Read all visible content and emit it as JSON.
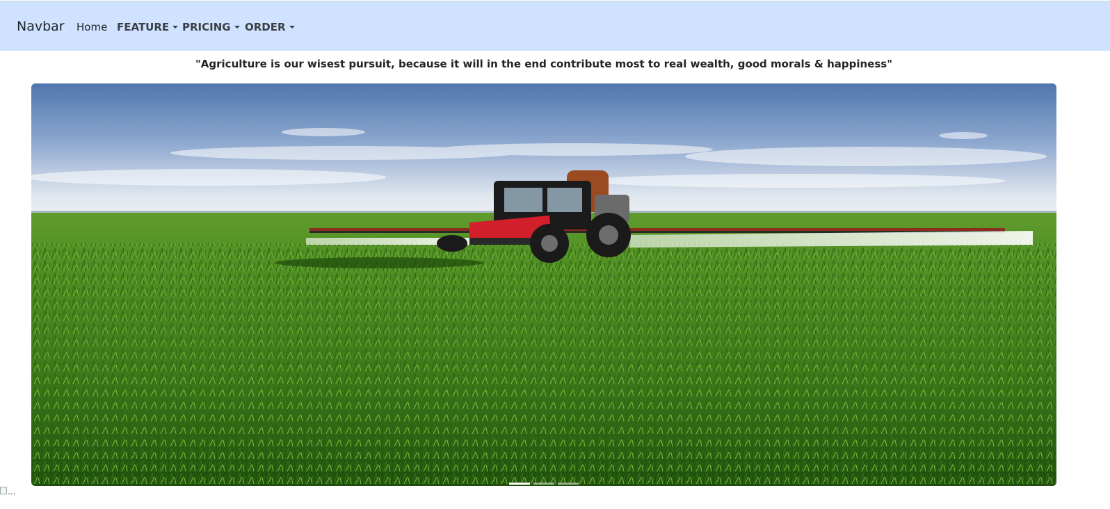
{
  "navbar": {
    "brand": "Navbar",
    "items": [
      {
        "label": "Home",
        "dropdown": false
      },
      {
        "label": "FEATURE",
        "dropdown": true
      },
      {
        "label": "PRICING",
        "dropdown": true
      },
      {
        "label": "ORDER",
        "dropdown": true
      }
    ]
  },
  "quote": "\"Agriculture is our wisest pursuit, because it will in the end contribute most to real wealth, good morals & happiness\"",
  "carousel": {
    "slide_count": 3,
    "active_index": 0
  },
  "broken_image": {
    "alt": "..."
  },
  "colors": {
    "navbar_bg": "#cfe2ff",
    "field_green": "#3f7f1d",
    "tractor_red": "#d11f2b"
  }
}
